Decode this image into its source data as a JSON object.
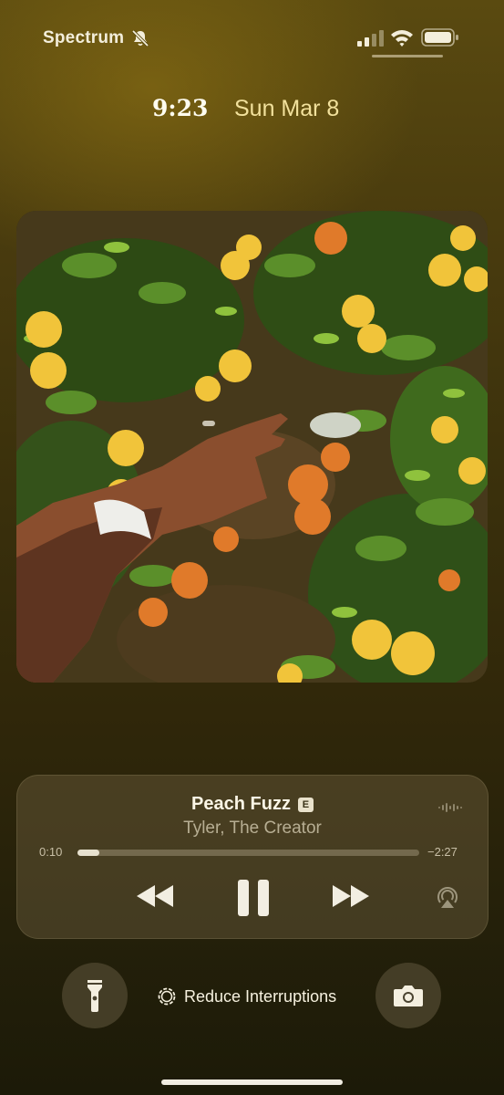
{
  "status_bar": {
    "carrier": "Spectrum",
    "icons": [
      "mute-icon",
      "signal-icon",
      "wifi-icon",
      "battery-icon"
    ]
  },
  "lock_screen": {
    "time": "9:23",
    "date": "Sun Mar 8"
  },
  "now_playing": {
    "title": "Peach Fuzz",
    "explicit_badge": "E",
    "artist": "Tyler, The Creator",
    "elapsed": "0:10",
    "remaining": "−2:27",
    "progress_fraction": 0.065,
    "controls": [
      "rewind-icon",
      "pause-icon",
      "fast-forward-icon",
      "airplay-icon"
    ]
  },
  "bottom": {
    "focus_label": "Reduce Interruptions",
    "left_button_icon": "flashlight-icon",
    "right_button_icon": "camera-icon"
  },
  "colors": {
    "date_accent": "#f2e19c",
    "background_dark": "#1c1a08",
    "background_top": "#5a4a10"
  }
}
